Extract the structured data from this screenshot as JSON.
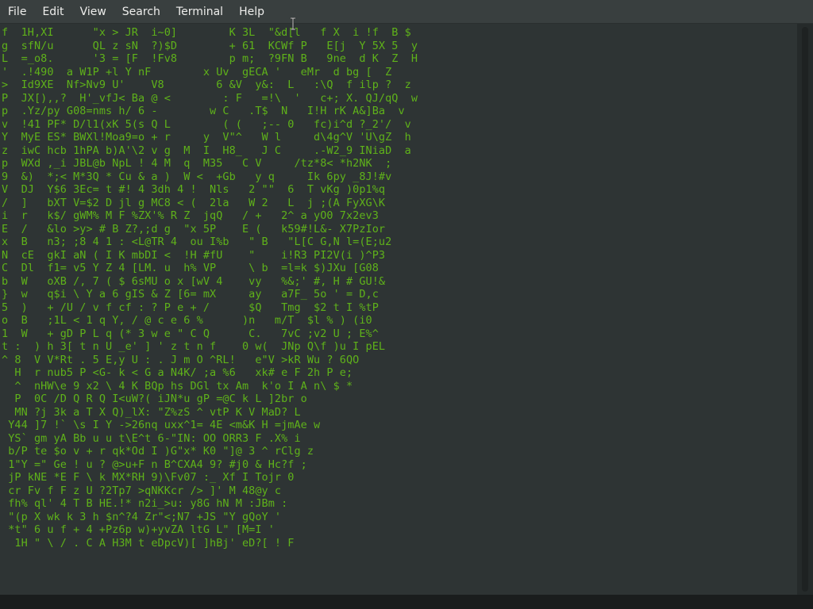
{
  "menubar": {
    "items": [
      "File",
      "Edit",
      "View",
      "Search",
      "Terminal",
      "Help"
    ]
  },
  "terminal": {
    "colors": {
      "text": "#5fb21a",
      "highlight": "#f2f2f2",
      "background": "#2e3434"
    },
    "lines": [
      "f  1H,XI      \"x > JR  i~0]        K 3L  \"&d[l   f X  i !f  B $",
      "g  sfN/u      QL z sN  ?)$D        + 61  KCWf P   E[j  Y 5X 5  y",
      "L  =_o8.      '3 = [F  !Fv8        p m;  ?9FN B   9ne  d K  Z  H",
      "'  .!490  a W1P +l Y nF        x Uv  gECA '   eMr  d bg [  Z",
      ">  Id9XE  Nf>Nv9 U'    V8        6 &V  y&:  L   :\\Q  f ilp ?  z",
      "P  JX[),,?  H'_vfJ< Ba @ <        : F   =!\\  '   c+; X. QJ/qQ  w",
      "p  .Yz/py G08=nms h/ 6 -        w C   .T$  N   I!H rK A&]Ba  v",
      "v  !41 PF* D/l1(xK 5(s Q L        ( (   ;-- 0   fc)i^d ?_2'/  v",
      "Y  MyE ES* BWXl!Moa9=o + r     y  V\"^   W l     d\\4g^V 'U\\gZ  h",
      "z  iwC hcb 1hPA b)A'\\2 v g  M  I  H8_   J C     .-W2_9 INiaD  a",
      "p  WXd ,_i JBL@b NpL ! 4 M  q  M35   C V     /tz*8< *h2NK  ;",
      "9  &)  *;< M*3Q * Cu & a )  W <  +Gb   y q     Ik 6py _8J!#v",
      "V  DJ  Y$6 3Ec= t #! 4 3dh 4 !  Nls   2 \"\"  6  T vKg )0p1%q",
      "/  ]   bXT V=$2 D jl g MC8 < (  2la   W 2   L  j ;(A FyXG\\K",
      "i  r   k$/ gWM% M F %ZX'% R Z  jqQ   / +   2^ a yO0 7x2ev3",
      "E  /   &lo >y> # B Z?,;d g  \"x 5P    E (   k59#!L&- X7PzIor",
      "x  B   n3; ;8 4 1 : <L@TR 4  ou I%b   \" B   \"L[C G,N l=(E;u2",
      "N  cE  gkI aN ( I K mbDI <  !H #fU    \"    i!R3 PI2V(i )^P3",
      "C  Dl  f1= v5 Y Z 4 [LM. u  h% VP     \\ b  =l=k $)JXu [G08",
      "b  W   oXB /, 7 ( $ 6sMU o x [wV 4    vy   %&;' #, H # GU!&",
      "}  w   q$i \\ Y a 6 gIS & Z [6= mX     ay   a7F_ 5o ' = D,c",
      "5  )   + /U / v f cf : ? P e + /      $Q   Tmg  $2 t I %tP",
      "o  B   ;1L < 1 q Y, / @ c e 6 %      )n   m/T  $l % ) (i0",
      "1  W   + gD P L q (* 3 w e \" C Q      C.   7vC ;v2 U ; E%^",
      "t :  ) h 3[ t n U _e' ] ' z t n f    0 w(  JNp Q\\f )u I pEL",
      "^ 8  V V*Rt . 5 E,y U : . J m O ^RL!   e\"V >kR Wu ? 6QO",
      "  H  r nub5 P <G- k < G a N4K/ ;a %6   xk# e F 2h P e;",
      "  ^  nHW\\e 9 x2 \\ 4 K BQp hs DGl tx Am  k'o I A n\\ $ *",
      "  P  0C /D Q R Q I<uW?( iJN*u gP =@C k L ]2br o",
      "  MN ?j 3k a T X Q)_lX: \"Z%zS ^ vtP K V MaD? L",
      " Y44 ]7 !` \\s I Y ->26nq uxx^1= 4E <m&K H =jmAe w",
      " YS` gm yA Bb u u t\\E^t 6-\"IN: OO ORR3 F .X% i",
      " b/P te $o v + r qk*Od I )G\"x* K0 \"]@ 3 ^ rClg z",
      " 1\"Y =\" Ge ! u ? @>u+F n B^CXA4 9? #j0 & Hc?f ;",
      " jP kNE *E F \\ k MX*RH 9)\\Fv07 :_ Xf I Tojr 0",
      " cr Fv f F z U ?2Tp7 >qNKKcr /> ]' M 48@y c",
      " fh% ql' 4 T B HE.!* n2i_>u: y8G hN M :JBm :",
      " \"(p X wk k 3 h $n^?4 Zr\"<;N7 +JS \"Y gQoY '",
      " *t\" 6 u f + 4 +Pz6p w)+yvZA ltG L\" [M=I '",
      "  1H \" \\ / . C A H3M t eDpcV)[ ]hBj' eD?[ ! F"
    ]
  }
}
